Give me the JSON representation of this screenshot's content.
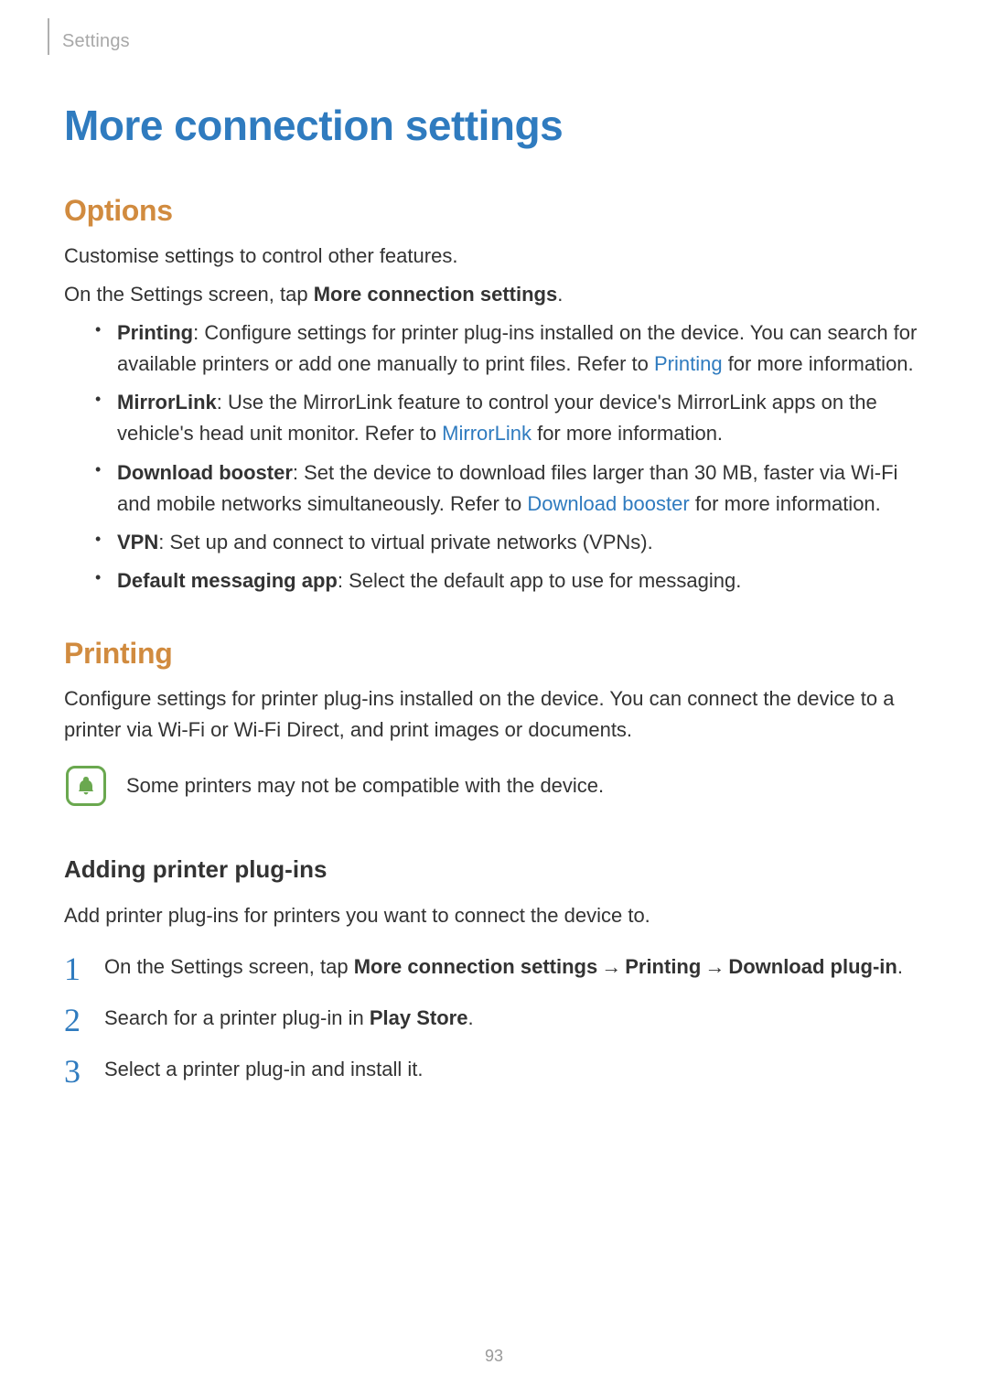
{
  "header": {
    "breadcrumb": "Settings"
  },
  "title": "More connection settings",
  "options": {
    "heading": "Options",
    "intro": "Customise settings to control other features.",
    "instruction_prefix": "On the Settings screen, tap ",
    "instruction_bold": "More connection settings",
    "instruction_suffix": ".",
    "items": [
      {
        "label": "Printing",
        "text_before": ": Configure settings for printer plug-ins installed on the device. You can search for available printers or add one manually to print files. Refer to ",
        "link": "Printing",
        "text_after": " for more information."
      },
      {
        "label": "MirrorLink",
        "text_before": ": Use the MirrorLink feature to control your device's MirrorLink apps on the vehicle's head unit monitor. Refer to ",
        "link": "MirrorLink",
        "text_after": " for more information."
      },
      {
        "label": "Download booster",
        "text_before": ": Set the device to download files larger than 30 MB, faster via Wi-Fi and mobile networks simultaneously. Refer to ",
        "link": "Download booster",
        "text_after": " for more information."
      },
      {
        "label": "VPN",
        "text_before": ": Set up and connect to virtual private networks (VPNs).",
        "link": "",
        "text_after": ""
      },
      {
        "label": "Default messaging app",
        "text_before": ": Select the default app to use for messaging.",
        "link": "",
        "text_after": ""
      }
    ]
  },
  "printing": {
    "heading": "Printing",
    "intro": "Configure settings for printer plug-ins installed on the device. You can connect the device to a printer via Wi-Fi or Wi-Fi Direct, and print images or documents.",
    "note": "Some printers may not be compatible with the device.",
    "subheading": "Adding printer plug-ins",
    "subintro": "Add printer plug-ins for printers you want to connect the device to.",
    "step1": {
      "prefix": "On the Settings screen, tap ",
      "b1": "More connection settings",
      "arrow": "→",
      "b2": "Printing",
      "b3": "Download plug-in",
      "suffix": "."
    },
    "step2": {
      "prefix": "Search for a printer plug-in in ",
      "bold": "Play Store",
      "suffix": "."
    },
    "step3": {
      "text": "Select a printer plug-in and install it."
    }
  },
  "page_number": "93"
}
